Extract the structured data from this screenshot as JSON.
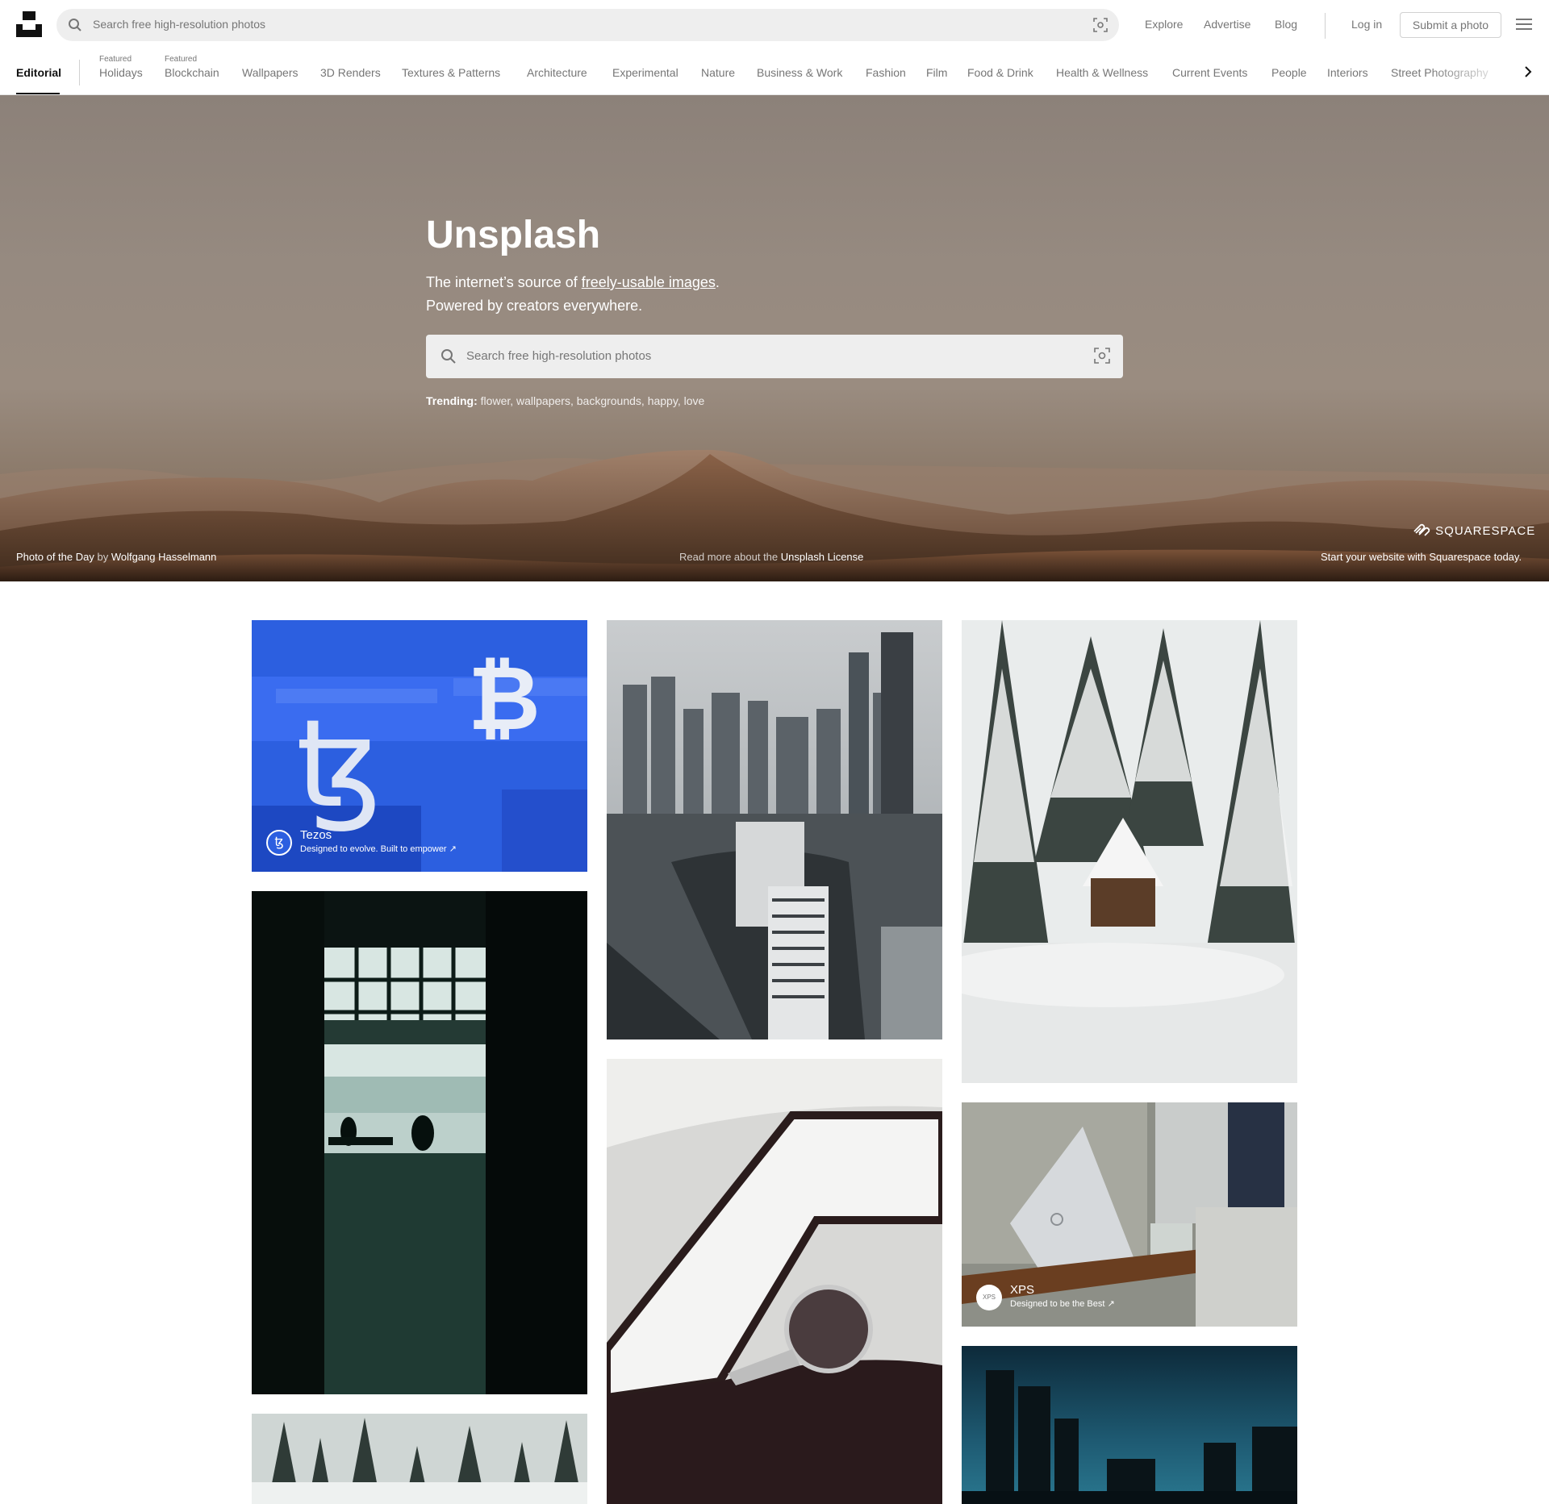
{
  "header": {
    "search_placeholder": "Search free high-resolution photos",
    "nav": [
      "Explore",
      "Advertise",
      "Blog"
    ],
    "login": "Log in",
    "submit": "Submit a photo"
  },
  "categories": {
    "active": "Editorial",
    "featured_label": "Featured",
    "featured": [
      "Holidays",
      "Blockchain"
    ],
    "items": [
      "Wallpapers",
      "3D Renders",
      "Textures & Patterns",
      "Architecture",
      "Experimental",
      "Nature",
      "Business & Work",
      "Fashion",
      "Film",
      "Food & Drink",
      "Health & Wellness",
      "Current Events",
      "People",
      "Interiors",
      "Street Photography"
    ]
  },
  "hero": {
    "title": "Unsplash",
    "subtitle_pre": "The internet’s source of ",
    "subtitle_link": "freely-usable images",
    "subtitle_post": ".",
    "subtitle_line2": "Powered by creators everywhere.",
    "search_placeholder": "Search free high-resolution photos",
    "trending_label": "Trending:",
    "trending": [
      "flower",
      "wallpapers",
      "backgrounds",
      "happy",
      "love"
    ],
    "photo_of_day_label": "Photo of the Day",
    "by": "by",
    "photographer": "Wolfgang Hasselmann",
    "license_pre": "Read more about the",
    "license_link": "Unsplash License",
    "sponsor_brand": "SQUARESPACE",
    "sponsor_tagline": "Start your website with Squarespace today."
  },
  "sponsored": [
    {
      "name": "Tezos",
      "tagline": "Designed to evolve. Built to empower ↗",
      "avatar": "ꜩ"
    },
    {
      "name": "XPS",
      "tagline": "Designed to be the Best ↗",
      "avatar": "XPS"
    }
  ],
  "colors": {
    "accent": "#111111",
    "muted": "#767676",
    "search_bg": "#eeeeee"
  }
}
